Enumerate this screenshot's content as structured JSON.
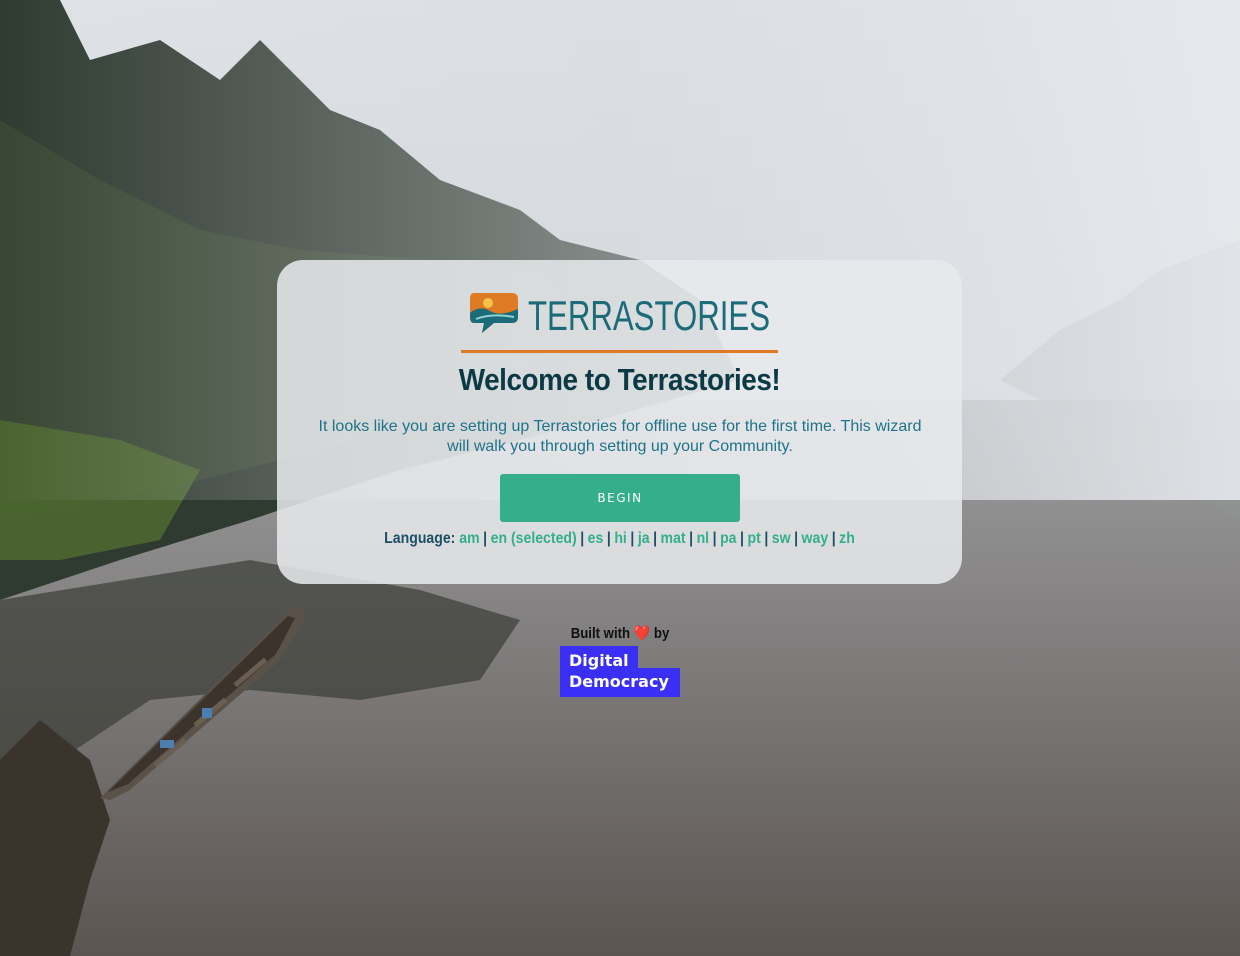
{
  "brand": {
    "logo_text": "TERRASTORIES",
    "colors": {
      "teal": "#1b6b78",
      "accent": "#e07b25",
      "green": "#35ae8b"
    }
  },
  "welcome": {
    "title": "Welcome to Terrastories!",
    "intro": "It looks like you are setting up Terrastories for offline use for the first time. This wizard will walk you through setting up your Community.",
    "begin_label": "BEGIN"
  },
  "language": {
    "label": "Language:",
    "options": [
      "am",
      "en (selected)",
      "es",
      "hi",
      "ja",
      "mat",
      "nl",
      "pa",
      "pt",
      "sw",
      "way",
      "zh"
    ]
  },
  "footer": {
    "built_with_prefix": "Built with",
    "heart": "❤️",
    "built_with_suffix": "by",
    "org_line1": "Digital",
    "org_line2": "Democracy",
    "org_color": "#3a2ff5"
  }
}
